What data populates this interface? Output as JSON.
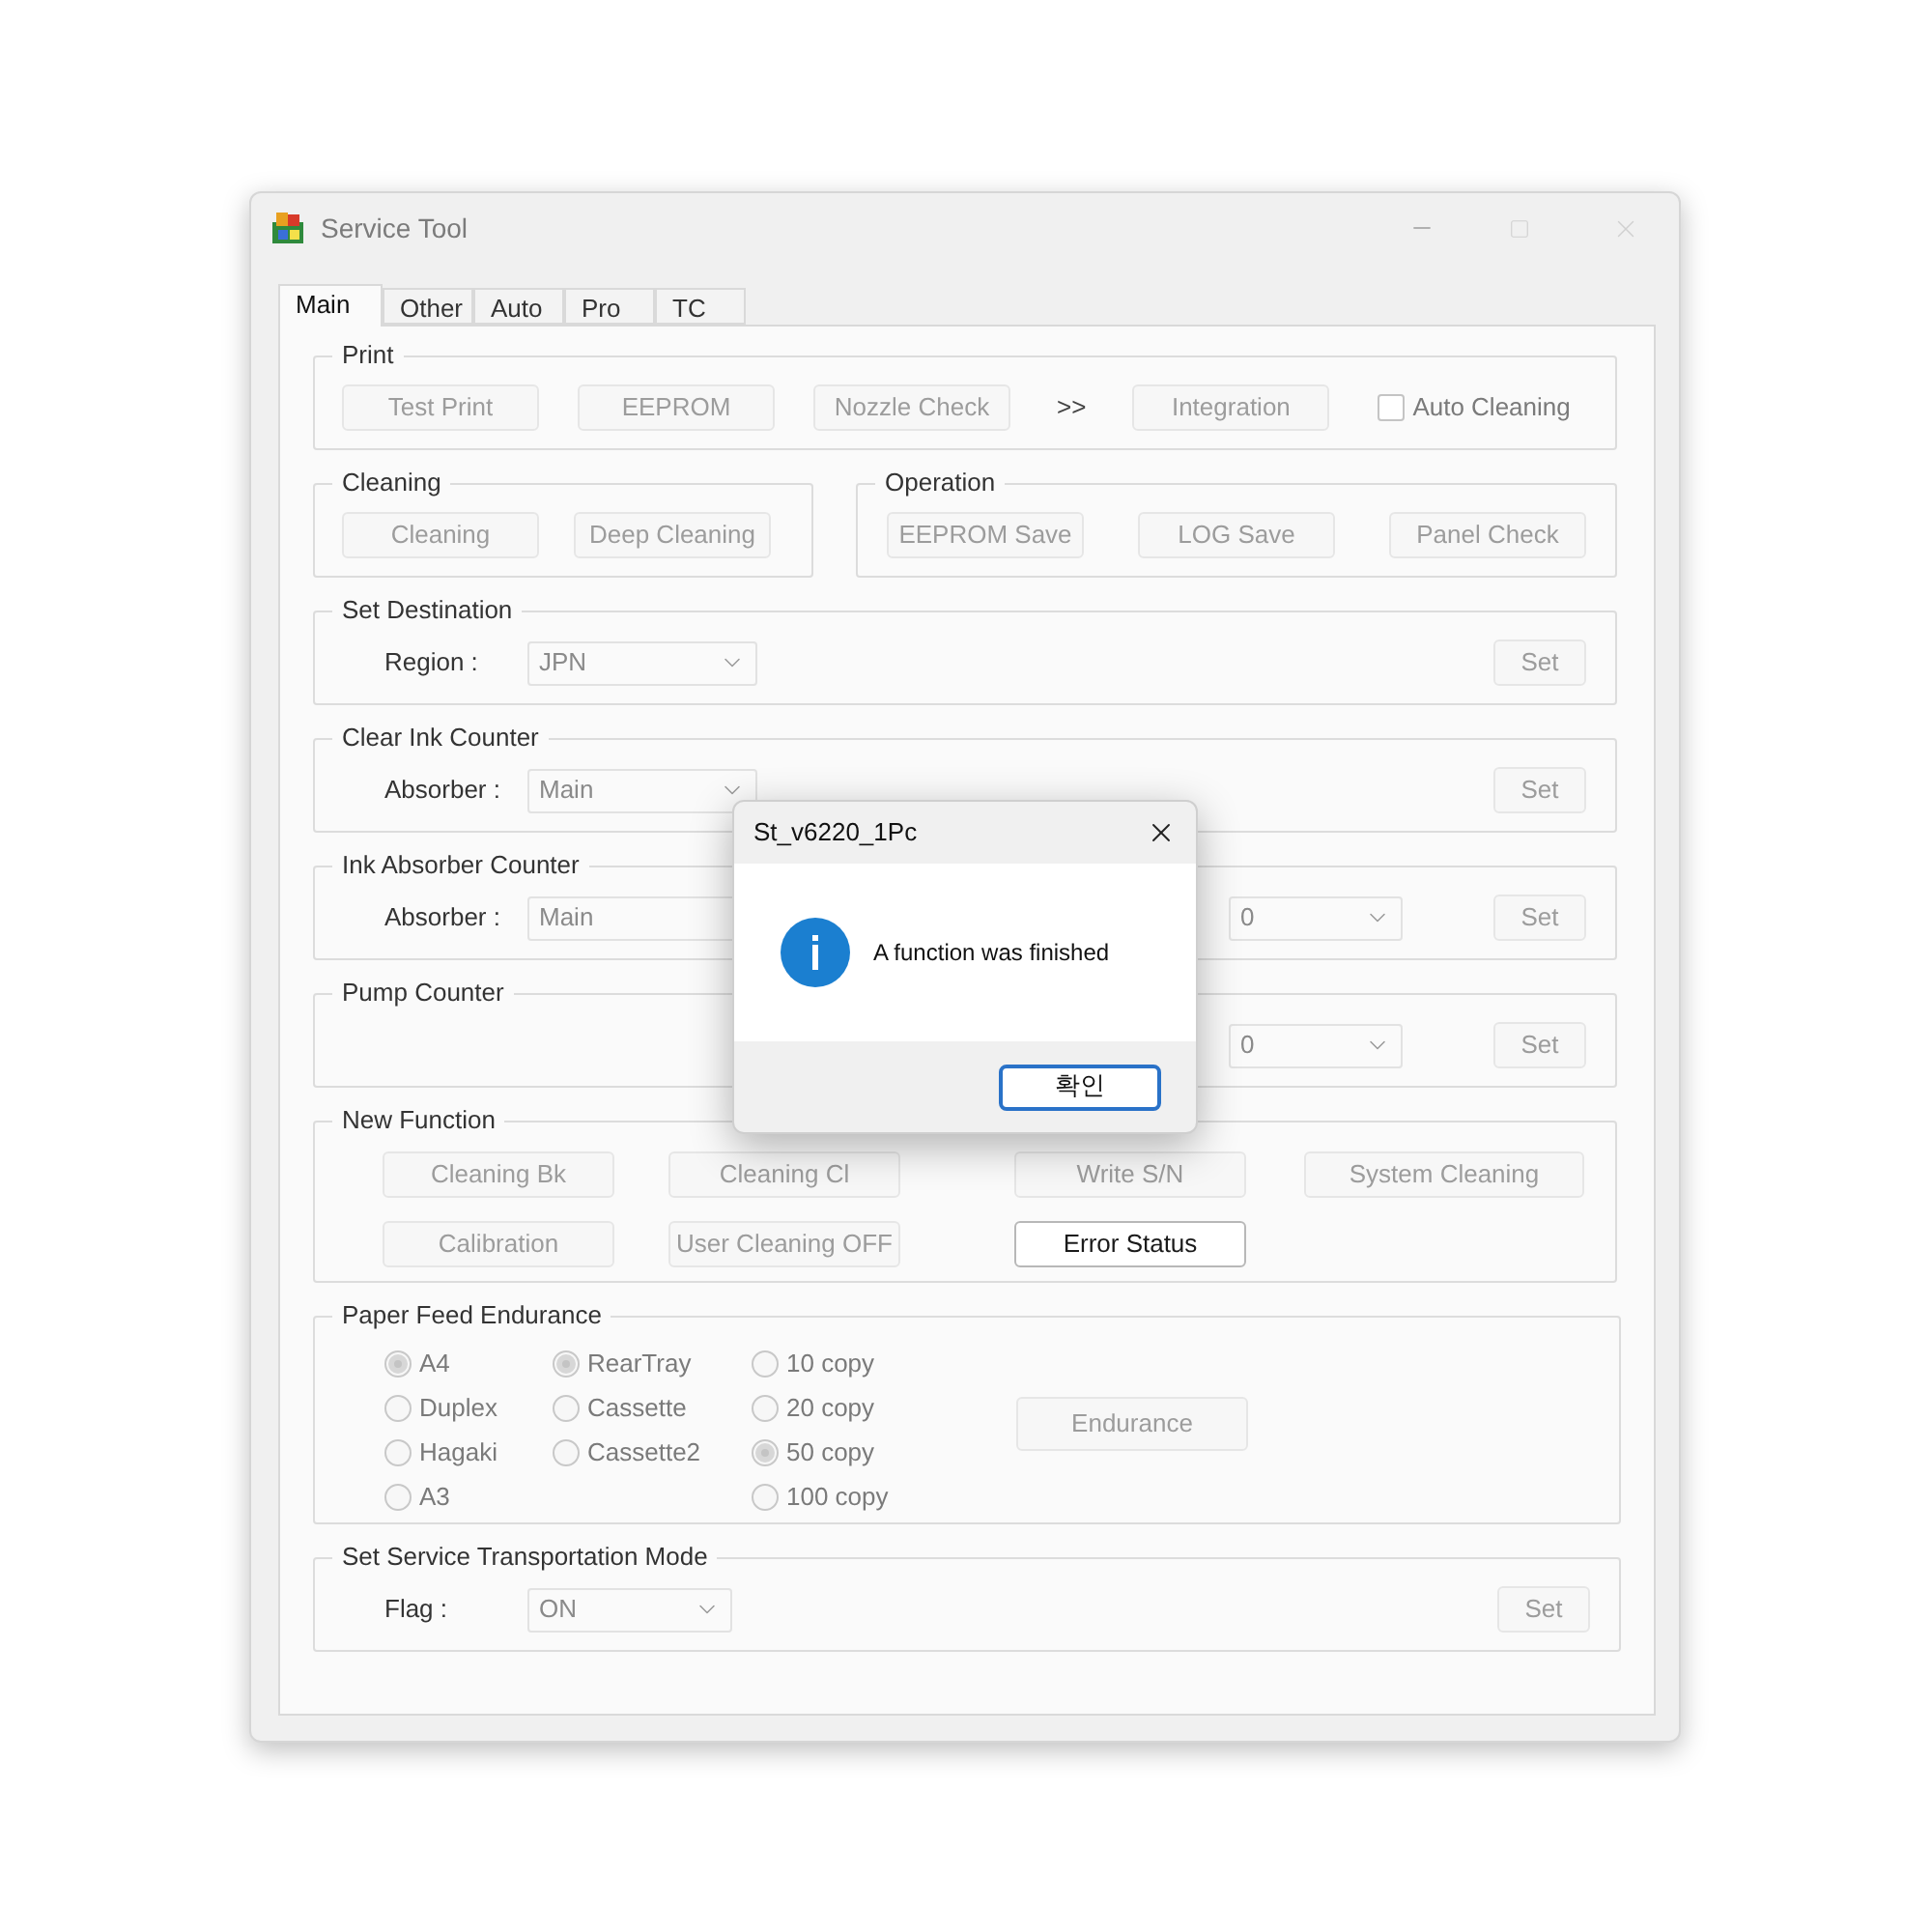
{
  "window": {
    "title": "Service Tool"
  },
  "tabs": [
    {
      "label": "Main",
      "selected": true
    },
    {
      "label": "Other",
      "selected": false
    },
    {
      "label": "Auto",
      "selected": false
    },
    {
      "label": "Pro",
      "selected": false
    },
    {
      "label": "TC",
      "selected": false
    }
  ],
  "print": {
    "title": "Print",
    "items": [
      {
        "kind": "button",
        "label": "Test Print",
        "disabled": true
      },
      {
        "kind": "button",
        "label": "EEPROM",
        "disabled": true
      },
      {
        "kind": "button",
        "label": "Nozzle Check",
        "disabled": true
      },
      {
        "kind": "text",
        "label": ">>"
      },
      {
        "kind": "button",
        "label": "Integration",
        "disabled": true
      },
      {
        "kind": "checkbox",
        "label": "Auto Cleaning",
        "checked": false
      }
    ]
  },
  "cleaning": {
    "title": "Cleaning",
    "buttons": [
      {
        "label": "Cleaning",
        "disabled": true
      },
      {
        "label": "Deep Cleaning",
        "disabled": true
      }
    ]
  },
  "operation": {
    "title": "Operation",
    "buttons": [
      {
        "label": "EEPROM Save",
        "disabled": true
      },
      {
        "label": "LOG Save",
        "disabled": true
      },
      {
        "label": "Panel Check",
        "disabled": true
      }
    ]
  },
  "set_destination": {
    "title": "Set Destination",
    "label": "Region :",
    "value": "JPN",
    "button": {
      "label": "Set",
      "disabled": true
    }
  },
  "clear_ink_counter": {
    "title": "Clear Ink Counter",
    "label": "Absorber :",
    "value": "Main",
    "button": {
      "label": "Set",
      "disabled": true
    }
  },
  "ink_absorber_counter": {
    "title": "Ink Absorber Counter",
    "label": "Absorber :",
    "value": "Main",
    "value_2": "0",
    "button": {
      "label": "Set",
      "disabled": true
    }
  },
  "pump_counter": {
    "title": "Pump Counter",
    "value": "0",
    "button": {
      "label": "Set",
      "disabled": true
    }
  },
  "new_function": {
    "title": "New Function",
    "buttons": [
      {
        "label": "Cleaning Bk",
        "disabled": true
      },
      {
        "label": "Cleaning Cl",
        "disabled": true
      },
      {
        "label": "Write S/N",
        "disabled": true
      },
      {
        "label": "System Cleaning",
        "disabled": true
      },
      {
        "label": "Calibration",
        "disabled": true
      },
      {
        "label": "User Cleaning OFF",
        "disabled": true
      },
      {
        "label": "Error Status",
        "disabled": false
      }
    ]
  },
  "paper_feed_endurance": {
    "title": "Paper Feed Endurance",
    "radio_groups": [
      [
        {
          "label": "A4",
          "selected": true
        },
        {
          "label": "Duplex",
          "selected": false
        },
        {
          "label": "Hagaki",
          "selected": false
        },
        {
          "label": "A3",
          "selected": false
        }
      ],
      [
        {
          "label": "RearTray",
          "selected": true
        },
        {
          "label": "Cassette",
          "selected": false
        },
        {
          "label": "Cassette2",
          "selected": false
        }
      ],
      [
        {
          "label": "10 copy",
          "selected": false
        },
        {
          "label": "20 copy",
          "selected": false
        },
        {
          "label": "50 copy",
          "selected": true
        },
        {
          "label": "100 copy",
          "selected": false
        }
      ]
    ],
    "button": {
      "label": "Endurance",
      "disabled": true
    }
  },
  "transportation_mode": {
    "title": "Set Service Transportation Mode",
    "label": "Flag :",
    "value": "ON",
    "button": {
      "label": "Set",
      "disabled": true
    }
  },
  "dialog": {
    "title": "St_v6220_1Pc",
    "message": "A function was finished",
    "button": "확인"
  }
}
